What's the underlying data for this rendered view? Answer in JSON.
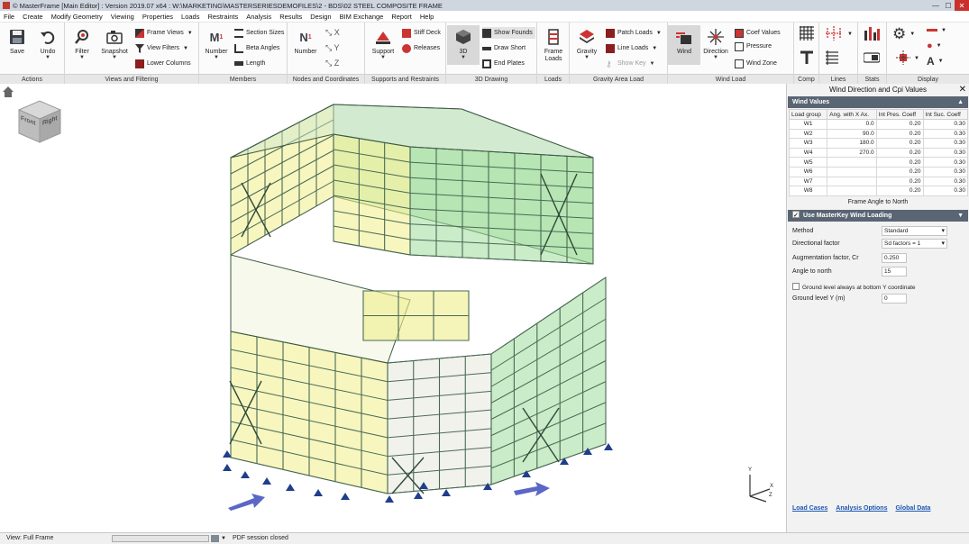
{
  "window": {
    "title": "© MasterFrame [Main Editor] : Version 2019.07 x64 : W:\\MARKETING\\MASTERSERIESDEMOFILES\\2 - BDS\\02 STEEL COMPOSITE FRAME",
    "controls": [
      "—",
      "☐",
      "✕"
    ]
  },
  "menu": [
    "File",
    "Create",
    "Modify Geometry",
    "Viewing",
    "Properties",
    "Loads",
    "Restraints",
    "Analysis",
    "Results",
    "Design",
    "BIM Exchange",
    "Report",
    "Help"
  ],
  "ribbon": {
    "groups": {
      "actions": "Actions",
      "views": "Views and Filtering",
      "members": "Members",
      "nodes": "Nodes and Coordinates",
      "supports": "Supports and Restraints",
      "drawing": "3D Drawing",
      "loads": "Loads",
      "gravity": "Gravity Area Load",
      "wind": "Wind Load",
      "comp": "Comp",
      "lines": "Lines",
      "stats": "Stats",
      "display": "Display"
    },
    "buttons": {
      "save": "Save",
      "undo": "Undo",
      "filter": "Filter",
      "snapshot": "Snapshot",
      "frame_views": "Frame Views",
      "view_filters": "View Filters",
      "lower_columns": "Lower Columns",
      "member_number": "Number",
      "section_sizes": "Section Sizes",
      "beta_angles": "Beta Angles",
      "length": "Length",
      "node_number": "Number",
      "support": "Support",
      "stiff_deck": "Stiff Deck",
      "releases": "Releases",
      "three_d": "3D",
      "show_founds": "Show Founds",
      "draw_short": "Draw Short",
      "end_plates": "End Plates",
      "frame_loads": "Frame Loads",
      "gravity": "Gravity",
      "patch_loads": "Patch Loads",
      "line_loads": "Line Loads",
      "show_key": "Show Key",
      "wind": "Wind",
      "direction": "Direction",
      "coef_values": "Coef Values",
      "pressure": "Pressure",
      "wind_zone": "Wind Zone"
    }
  },
  "viewcube": {
    "front": "Front",
    "right": "Right"
  },
  "axis": {
    "y": "Y",
    "x": "X",
    "z": "Z"
  },
  "panel": {
    "title": "Wind Direction and Cpi Values",
    "close": "✕",
    "wind_values": {
      "header": "Wind Values",
      "columns": [
        "Load group",
        "Ang. with X Ax.",
        "Int Pres. Coeff",
        "Int Suc. Coeff"
      ],
      "rows": [
        [
          "W1",
          "0.0",
          "0.20",
          "0.30"
        ],
        [
          "W2",
          "90.0",
          "0.20",
          "0.30"
        ],
        [
          "W3",
          "180.0",
          "0.20",
          "0.30"
        ],
        [
          "W4",
          "270.0",
          "0.20",
          "0.30"
        ],
        [
          "W5",
          "",
          "0.20",
          "0.30"
        ],
        [
          "W6",
          "",
          "0.20",
          "0.30"
        ],
        [
          "W7",
          "",
          "0.20",
          "0.30"
        ],
        [
          "W8",
          "",
          "0.20",
          "0.30"
        ]
      ],
      "footer": "Frame Angle to North"
    },
    "masterkey": {
      "header": "Use MasterKey Wind Loading",
      "method_label": "Method",
      "method_value": "Standard",
      "directional_label": "Directional factor",
      "directional_value": "Sd factors = 1",
      "augmentation_label": "Augmentation factor, Cr",
      "augmentation_value": "0.250",
      "angle_label": "Angle to north",
      "angle_value": "15",
      "ground_check_label": "Ground level always at bottom Y coordinate",
      "ground_level_label": "Ground level Y (m)",
      "ground_level_value": "0"
    },
    "links": [
      "Load Cases",
      "Analysis Options",
      "Global Data"
    ]
  },
  "status": {
    "view": "View: Full Frame",
    "message": "PDF session closed"
  },
  "colors": {
    "ribbon_label_bg": "#e7e7e7",
    "panel_header": "#5a6574",
    "structure_green": "#9fdc9a",
    "structure_yellow": "#f0ef8a",
    "support_blue": "#1f3e8c",
    "wind_arrow": "#5a67c6"
  }
}
